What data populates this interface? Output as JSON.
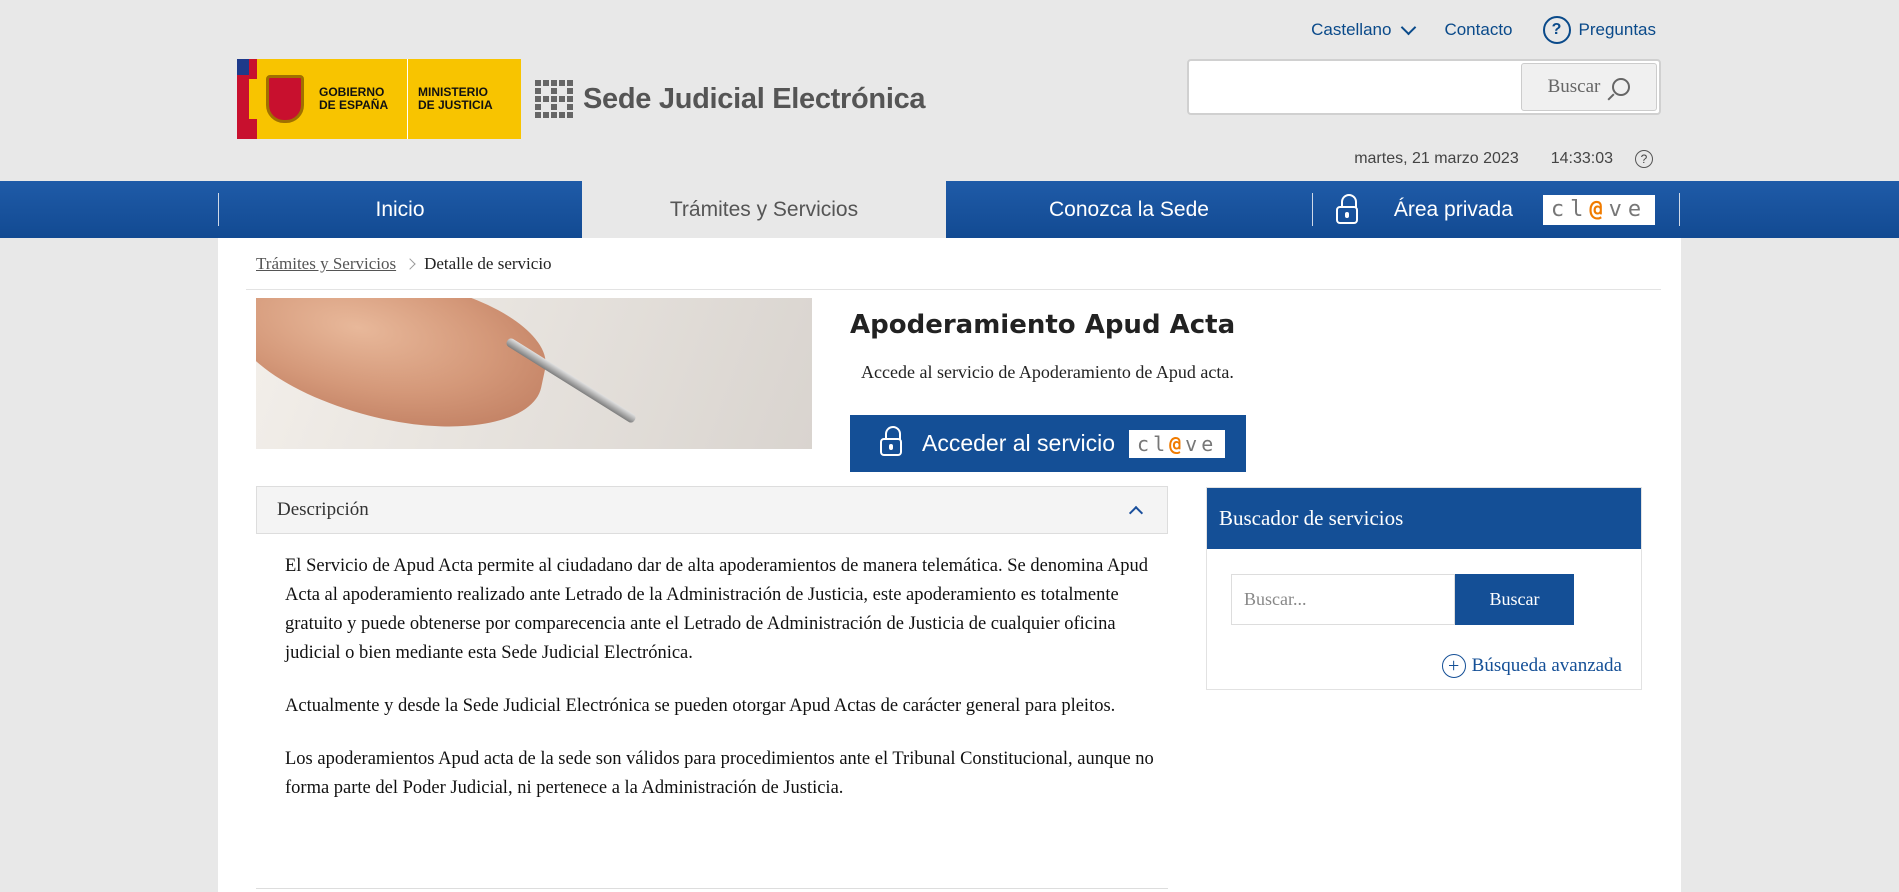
{
  "utility": {
    "language": "Castellano",
    "contact": "Contacto",
    "faq": "Preguntas",
    "help_icon": "question-circle-icon"
  },
  "logo": {
    "gov_line1": "GOBIERNO\nDE ESPAÑA",
    "gov_line2": "MINISTERIO\nDE JUSTICIA",
    "site_title": "Sede Judicial Electrónica",
    "gov_color": "#f8c400"
  },
  "search": {
    "value": "",
    "button_label": "Buscar"
  },
  "datetime": {
    "date": "martes, 21 marzo 2023",
    "time": "14:33:03"
  },
  "nav": {
    "color": "#144f96",
    "tabs": [
      {
        "label": "Inicio",
        "active": false
      },
      {
        "label": "Trámites y Servicios",
        "active": true
      },
      {
        "label": "Conozca la Sede",
        "active": false
      },
      {
        "label": "Área privada",
        "active": false
      }
    ],
    "clave_brand": "clave"
  },
  "breadcrumb": {
    "items": [
      "Trámites y Servicios"
    ],
    "current": "Detalle de servicio"
  },
  "service": {
    "title": "Apoderamiento Apud Acta",
    "subtitle": "Accede al servicio de Apoderamiento de Apud acta.",
    "access_button": "Acceder al servicio"
  },
  "description": {
    "header": "Descripción",
    "paragraphs": [
      "El Servicio de Apud Acta permite al ciudadano dar de alta apoderamientos de manera telemática. Se denomina Apud Acta al apoderamiento realizado ante Letrado de la Administración de Justicia, este apoderamiento es totalmente gratuito y puede obtenerse por comparecencia ante el Letrado de Administración de Justicia de cualquier oficina judicial o bien mediante esta Sede Judicial Electrónica.",
      "Actualmente y desde la Sede Judicial Electrónica se pueden otorgar Apud Actas de carácter general para pleitos.",
      "Los apoderamientos Apud acta de la sede son válidos para procedimientos ante el Tribunal Constitucional, aunque no forma parte del Poder Judicial, ni pertenece a la Administración de Justicia."
    ]
  },
  "finder": {
    "title": "Buscador de servicios",
    "placeholder": "Buscar...",
    "button": "Buscar",
    "advanced": "Búsqueda avanzada"
  }
}
